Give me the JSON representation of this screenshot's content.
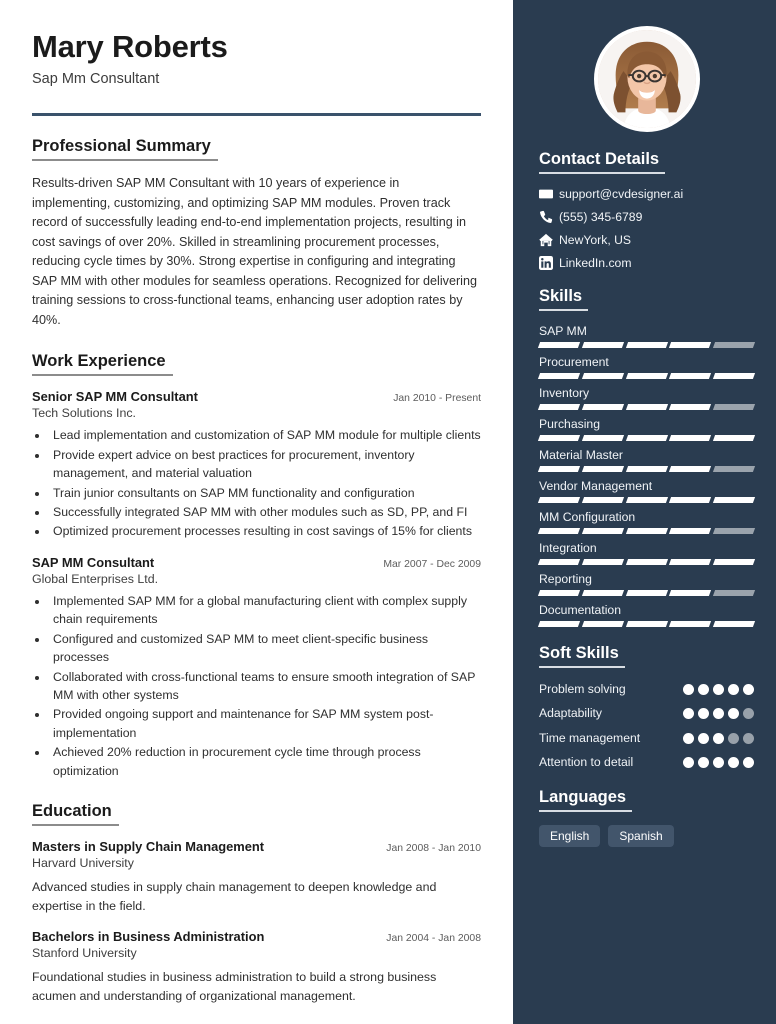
{
  "header": {
    "name": "Mary Roberts",
    "job_title": "Sap Mm Consultant"
  },
  "sections": {
    "professional_summary": {
      "heading": "Professional Summary",
      "text": "Results-driven SAP MM Consultant with 10 years of experience in implementing, customizing, and optimizing SAP MM modules. Proven track record of successfully leading end-to-end implementation projects, resulting in cost savings of over 20%. Skilled in streamlining procurement processes, reducing cycle times by 30%. Strong expertise in configuring and integrating SAP MM with other modules for seamless operations. Recognized for delivering training sessions to cross-functional teams, enhancing user adoption rates by 40%."
    },
    "work_experience": {
      "heading": "Work Experience",
      "entries": [
        {
          "title": "Senior SAP MM Consultant",
          "date": "Jan 2010 - Present",
          "organization": "Tech Solutions Inc.",
          "bullets": [
            "Lead implementation and customization of SAP MM module for multiple clients",
            "Provide expert advice on best practices for procurement, inventory management, and material valuation",
            "Train junior consultants on SAP MM functionality and configuration",
            "Successfully integrated SAP MM with other modules such as SD, PP, and FI",
            "Optimized procurement processes resulting in cost savings of 15% for clients"
          ]
        },
        {
          "title": "SAP MM Consultant",
          "date": "Mar 2007 - Dec 2009",
          "organization": "Global Enterprises Ltd.",
          "bullets": [
            "Implemented SAP MM for a global manufacturing client with complex supply chain requirements",
            "Configured and customized SAP MM to meet client-specific business processes",
            "Collaborated with cross-functional teams to ensure smooth integration of SAP MM with other systems",
            "Provided ongoing support and maintenance for SAP MM system post-implementation",
            "Achieved 20% reduction in procurement cycle time through process optimization"
          ]
        }
      ]
    },
    "education": {
      "heading": "Education",
      "entries": [
        {
          "title": "Masters in Supply Chain Management",
          "date": "Jan 2008 - Jan 2010",
          "organization": "Harvard University",
          "description": "Advanced studies in supply chain management to deepen knowledge and expertise in the field."
        },
        {
          "title": "Bachelors in Business Administration",
          "date": "Jan 2004 - Jan 2008",
          "organization": "Stanford University",
          "description": "Foundational studies in business administration to build a strong business acumen and understanding of organizational management."
        }
      ]
    }
  },
  "sidebar": {
    "photo_alt": "profile-photo",
    "contact": {
      "heading": "Contact Details",
      "items": [
        {
          "icon": "envelope-icon",
          "value": "support@cvdesigner.ai"
        },
        {
          "icon": "phone-icon",
          "value": "(555) 345-6789"
        },
        {
          "icon": "home-icon",
          "value": "NewYork, US"
        },
        {
          "icon": "linkedin-icon",
          "value": "LinkedIn.com"
        }
      ]
    },
    "skills": {
      "heading": "Skills",
      "max": 5,
      "items": [
        {
          "label": "SAP MM",
          "level": 4
        },
        {
          "label": "Procurement",
          "level": 5
        },
        {
          "label": "Inventory",
          "level": 4
        },
        {
          "label": "Purchasing",
          "level": 5
        },
        {
          "label": "Material Master",
          "level": 4
        },
        {
          "label": "Vendor Management",
          "level": 5
        },
        {
          "label": "MM Configuration",
          "level": 4
        },
        {
          "label": "Integration",
          "level": 5
        },
        {
          "label": "Reporting",
          "level": 4
        },
        {
          "label": "Documentation",
          "level": 5
        }
      ]
    },
    "soft_skills": {
      "heading": "Soft Skills",
      "max": 5,
      "items": [
        {
          "label": "Problem solving",
          "level": 5
        },
        {
          "label": "Adaptability",
          "level": 4
        },
        {
          "label": "Time management",
          "level": 3
        },
        {
          "label": "Attention to detail",
          "level": 5
        }
      ]
    },
    "languages": {
      "heading": "Languages",
      "items": [
        "English",
        "Spanish"
      ]
    }
  },
  "colors": {
    "sidebar_bg": "#2a3c50",
    "rule": "#3a526b",
    "accent_text": "#ffffff",
    "segment_off": "#9aa3ac",
    "lang_chip": "#42556b"
  }
}
